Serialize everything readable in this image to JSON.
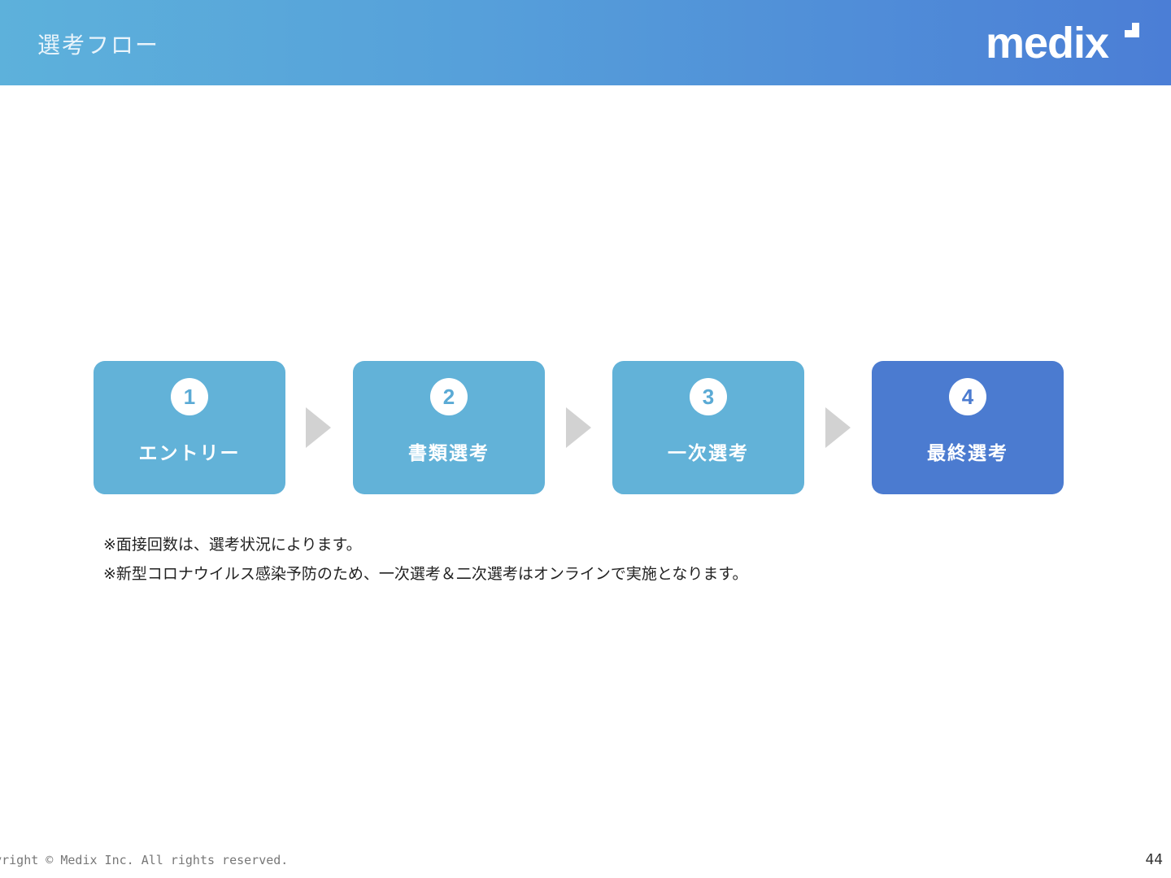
{
  "header": {
    "title": "選考フロー",
    "logo_text": "medix"
  },
  "colors": {
    "header_gradient_start": "#5db1db",
    "header_gradient_end": "#4b7ed6",
    "step_color": "#62b2d8",
    "final_step_color": "#4b7bd0",
    "arrow_color": "#d2d2d2"
  },
  "steps": [
    {
      "number": "1",
      "label": "エントリー"
    },
    {
      "number": "2",
      "label": "書類選考"
    },
    {
      "number": "3",
      "label": "一次選考"
    },
    {
      "number": "4",
      "label": "最終選考"
    }
  ],
  "notes": [
    "※面接回数は、選考状況によります。",
    "※新型コロナウイルス感染予防のため、一次選考＆二次選考はオンラインで実施となります。"
  ],
  "footer": {
    "copyright": "Copyright © Medix Inc. All rights reserved.",
    "page_number": "44"
  }
}
